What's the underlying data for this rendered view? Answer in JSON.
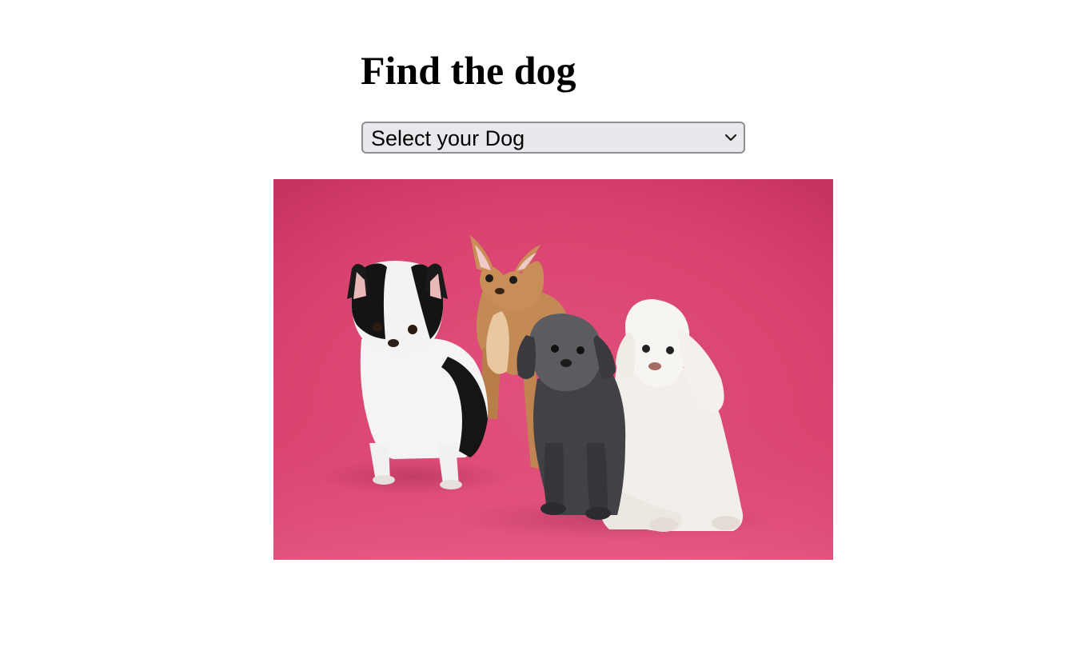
{
  "page": {
    "heading": "Find the dog"
  },
  "dog_select": {
    "selected_label": "Select your Dog",
    "icon": "chevron-down-icon"
  },
  "photo": {
    "subject": "four small dogs on a pink backdrop",
    "background_color": "#d9426e",
    "dogs": [
      {
        "name": "black-and-white long-haired dog",
        "colors": [
          "#111111",
          "#f4f4f4"
        ]
      },
      {
        "name": "tan short-haired dog",
        "colors": [
          "#c48a55",
          "#e7c29a"
        ]
      },
      {
        "name": "grey curly-coated dog",
        "colors": [
          "#3b3b3d",
          "#6d6d70"
        ]
      },
      {
        "name": "white poodle",
        "colors": [
          "#f3f1ee",
          "#ddd8d2"
        ]
      }
    ]
  }
}
